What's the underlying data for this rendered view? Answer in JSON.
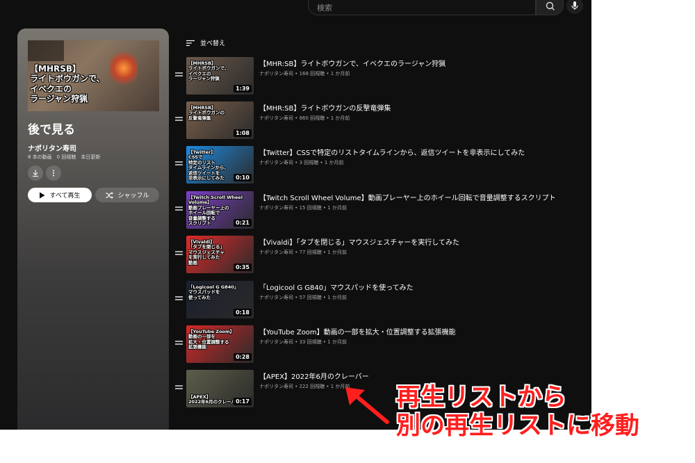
{
  "search": {
    "placeholder": "検索"
  },
  "playlist": {
    "thumb_text": "【MHRSB】\nライトボウガンで、\nイベクエの\nラージャン狩猟",
    "title": "後で見る",
    "owner": "ナポリタン寿司",
    "stats": "8 本の動画　0 回視聴　本日更新",
    "play_all_label": "すべて再生",
    "shuffle_label": "シャッフル"
  },
  "sort_label": "並べ替え",
  "videos": [
    {
      "title": "【MHR:SB】ライトボウガンで、イベクエのラージャン狩猟",
      "meta": "ナポリタン寿司 • 168 回視聴 • 1 か月前",
      "duration": "1:39",
      "thumb_text": "【MHRSB】\nライトボウガンで、\nイベクエの\nラージャン狩猟",
      "thumb_color": "#6b5a4c"
    },
    {
      "title": "【MHR:SB】ライトボウガンの反撃竜弾集",
      "meta": "ナポリタン寿司 • 860 回視聴 • 1 か月前",
      "duration": "1:08",
      "thumb_text": "【MHRSB】\nライトボウガンの\n反撃竜弾集",
      "thumb_color": "#7a5f4a"
    },
    {
      "title": "【Twitter】CSSで特定のリストタイムラインから、返信ツイートを非表示にしてみた",
      "meta": "ナポリタン寿司 • 3 回視聴 • 1 か月前",
      "duration": "0:10",
      "thumb_text": "【Twitter】\nCSSで\n特定のリスト\nタイムラインから、\n返信ツイートを\n非表示にしてみた",
      "thumb_color": "#1d8ae0"
    },
    {
      "title": "【Twitch Scroll Wheel Volume】動画プレーヤー上のホイール回転で音量調整するスクリプト",
      "meta": "ナポリタン寿司 • 15 回視聴 • 1 か月前",
      "duration": "0:21",
      "thumb_text": "【Twitch Scroll Wheel Volume】\n動画プレーヤー上の\nホイール回転で\n音量調整する\nスクリプト",
      "thumb_color": "#7b3fc4"
    },
    {
      "title": "【Vivaldi】「タブを閉じる」マウスジェスチャーを実行してみた",
      "meta": "ナポリタン寿司 • 77 回視聴 • 1 か月前",
      "duration": "0:35",
      "thumb_text": "【Vivaldi】\n「タブを閉じる」\nマウスジェスチャ\nを実行してみた\n動画",
      "thumb_color": "#e02a2a"
    },
    {
      "title": "「Logicool G G840」マウスパッドを使ってみた",
      "meta": "ナポリタン寿司 • 57 回視聴 • 1 か月前",
      "duration": "0:18",
      "thumb_text": "「Logicool G G840」\nマウスパッドを\n使ってみた",
      "thumb_color": "#1a1f2c"
    },
    {
      "title": "【YouTube Zoom】動画の一部を拡大・位置調整する拡張機能",
      "meta": "ナポリタン寿司 • 33 回視聴 • 1 か月前",
      "duration": "0:28",
      "thumb_text": "【YouTube Zoom】\n動画の一部を\n拡大・位置調整する\n拡張機能",
      "thumb_color": "#d42828"
    },
    {
      "title": "【APEX】2022年6月のクレーバー",
      "meta": "ナポリタン寿司 • 222 回視聴 • 1 か月前",
      "duration": "0:17",
      "thumb_text": "【APEX】\n2022年6月のクレーバー",
      "thumb_color": "#5e5e4a"
    }
  ],
  "annotation": "再生リストから\n別の再生リストに移動",
  "colors": {
    "annotation": "#ff1f1f",
    "background": "#0f0f0f"
  }
}
